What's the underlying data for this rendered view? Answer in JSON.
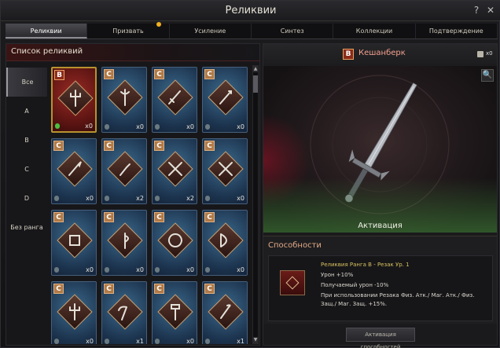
{
  "window": {
    "title": "Реликвии",
    "help_label": "?",
    "close_label": "✕"
  },
  "tabs": [
    {
      "label": "Реликвии",
      "active": true
    },
    {
      "label": "Призвать",
      "active": false,
      "notify": true
    },
    {
      "label": "Усиление",
      "active": false
    },
    {
      "label": "Синтез",
      "active": false
    },
    {
      "label": "Коллекции",
      "active": false
    },
    {
      "label": "Подтверждение",
      "active": false
    }
  ],
  "list": {
    "title": "Список реликвий",
    "grades": [
      "Все",
      "A",
      "B",
      "C",
      "D",
      "Без ранга"
    ],
    "active_grade": "Все",
    "items": [
      {
        "grade": "B",
        "count": "x0",
        "icon": "trident-icon"
      },
      {
        "grade": "C",
        "count": "x0",
        "icon": "halberd-icon"
      },
      {
        "grade": "C",
        "count": "x0",
        "icon": "sword-icon"
      },
      {
        "grade": "C",
        "count": "x0",
        "icon": "lance-icon"
      },
      {
        "grade": "C",
        "count": "x0",
        "icon": "spear-icon"
      },
      {
        "grade": "C",
        "count": "x2",
        "icon": "mace-icon"
      },
      {
        "grade": "C",
        "count": "x2",
        "icon": "crossed-swords-icon"
      },
      {
        "grade": "C",
        "count": "x0",
        "icon": "crossed-swords-icon"
      },
      {
        "grade": "C",
        "count": "x0",
        "icon": "bracer-icon"
      },
      {
        "grade": "C",
        "count": "x0",
        "icon": "axe-icon"
      },
      {
        "grade": "C",
        "count": "x0",
        "icon": "chakram-icon"
      },
      {
        "grade": "C",
        "count": "x0",
        "icon": "bow-icon"
      },
      {
        "grade": "C",
        "count": "x0",
        "icon": "trident-icon"
      },
      {
        "grade": "C",
        "count": "x1",
        "icon": "scythe-icon"
      },
      {
        "grade": "C",
        "count": "x0",
        "icon": "hammer-icon"
      },
      {
        "grade": "C",
        "count": "x1",
        "icon": "glaive-icon"
      }
    ]
  },
  "detail": {
    "grade": "B",
    "name": "Кешанберк",
    "book_count": "x0",
    "magnify_label": "🔍",
    "activation_label": "Активация",
    "abilities_title": "Способности",
    "ability_lines": [
      "Реликвия Ранга B - Резак Ур. 1",
      "Урон +10%",
      "Получаемый урон -10%",
      "При использовании Резака Физ. Атк./ Маг. Атк./ Физ. Защ./ Маг. Защ. +15%."
    ],
    "activate_button": "Активация способностей"
  },
  "colors": {
    "accent_red": "#f2a090",
    "grade_c": "#b07a48",
    "grade_b": "#8a2a1a",
    "ability_title": "#d8c060"
  }
}
